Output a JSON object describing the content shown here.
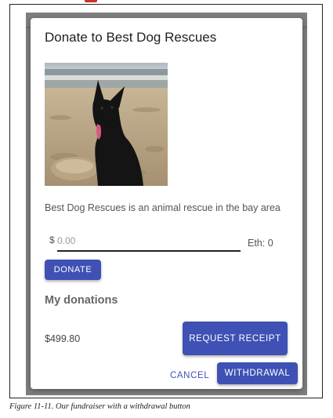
{
  "dialog": {
    "title": "Donate to Best Dog Rescues",
    "image_alt": "black dog on beach",
    "description": "Best Dog Rescues is an animal rescue in the bay area"
  },
  "donation_form": {
    "currency_symbol": "$",
    "amount_placeholder": "0.00",
    "amount_value": "",
    "eth_label": "Eth: 0",
    "donate_label": "DONATE"
  },
  "my_donations": {
    "heading": "My donations",
    "total": "$499.80",
    "request_receipt_label": "REQUEST RECEIPT"
  },
  "actions": {
    "cancel_label": "CANCEL",
    "withdrawal_label": "WITHDRAWAL"
  },
  "caption": "Figure 11-11. Our fundraiser with a withdrawal button",
  "colors": {
    "primary": "#3f51b5",
    "backdrop": "#7f7f7f"
  }
}
